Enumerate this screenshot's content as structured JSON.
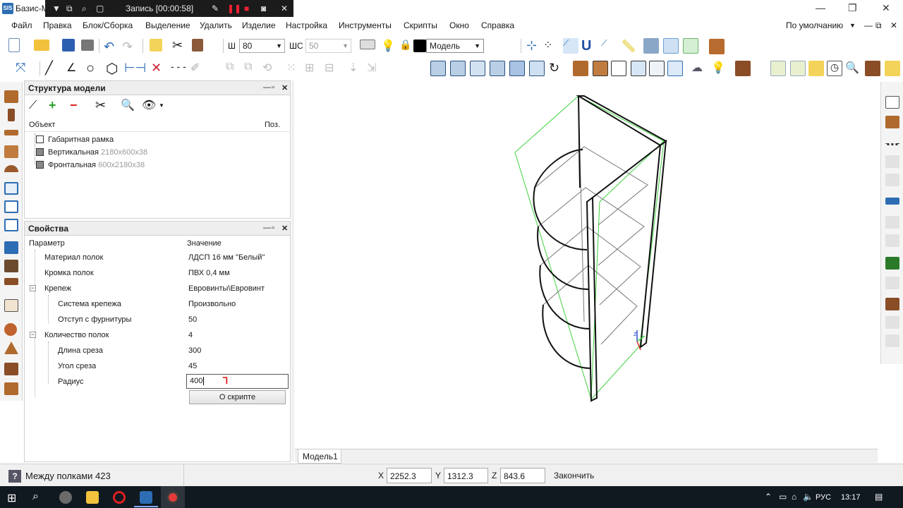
{
  "window": {
    "title": "Базис-М"
  },
  "recorder": {
    "label": "Запись [00:00:58]"
  },
  "menu": [
    "Файл",
    "Правка",
    "Блок/Сборка",
    "Выделение",
    "Удалить",
    "Изделие",
    "Настройка",
    "Инструменты",
    "Скрипты",
    "Окно",
    "Справка"
  ],
  "preset": "По умолчанию",
  "toolbar": {
    "w_label": "Ш",
    "w_value": "80",
    "ws_label": "ШС",
    "ws_value": "50",
    "model_label": "Модель"
  },
  "structure": {
    "title": "Структура модели",
    "col_object": "Объект",
    "col_pos": "Поз.",
    "items": [
      {
        "name": "Габаритная рамка",
        "dims": ""
      },
      {
        "name": "Вертикальная",
        "dims": "2180x600x38"
      },
      {
        "name": "Фронтальная",
        "dims": "600x2180x38"
      }
    ]
  },
  "properties": {
    "title": "Свойства",
    "col_param": "Параметр",
    "col_value": "Значение",
    "rows": [
      {
        "name": "Материал полок",
        "value": "ЛДСП 16 мм \"Белый\""
      },
      {
        "name": "Кромка полок",
        "value": "ПВХ 0,4 мм"
      },
      {
        "name": "Крепеж",
        "value": "Евровинты\\Евровинт"
      },
      {
        "name": "Система крепежа",
        "value": "Произвольно"
      },
      {
        "name": "Отступ с фурнитуры",
        "value": "50"
      },
      {
        "name": "Количество полок",
        "value": "4"
      },
      {
        "name": "Длина среза",
        "value": "300"
      },
      {
        "name": "Угол среза",
        "value": "45"
      },
      {
        "name": "Радиус",
        "value": "400"
      }
    ],
    "about_button": "О скрипте"
  },
  "viewport_tab": "Модель1",
  "status": {
    "message": "Между полками 423",
    "x_label": "X",
    "x_value": "2252.3",
    "y_label": "Y",
    "y_value": "1312.3",
    "z_label": "Z",
    "z_value": "843.6",
    "finish": "Закончить"
  },
  "taskbar": {
    "lang": "РУС",
    "time": "13:17"
  },
  "colors": {
    "accent": "#2d6db3",
    "bbox_green": "#3fd13f",
    "taskbar": "#101820"
  }
}
